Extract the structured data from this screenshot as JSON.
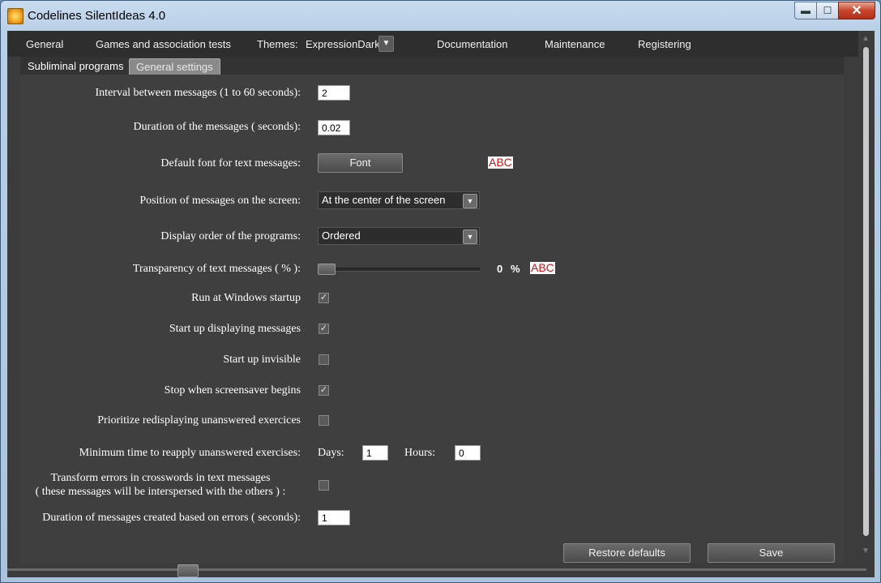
{
  "window": {
    "title": "Codelines SilentIdeas 4.0",
    "min_icon": "minimize-icon",
    "max_icon": "maximize-icon",
    "close_icon": "close-icon"
  },
  "menu": {
    "items": [
      "General",
      "Games and association tests",
      "Themes:",
      "Documentation",
      "Maintenance",
      "Registering"
    ],
    "theme_value": "ExpressionDark"
  },
  "subtabs": [
    "Subliminal programs",
    "General settings"
  ],
  "form": {
    "interval_label": "Interval between messages (1 to 60 seconds):",
    "interval_value": "2",
    "duration_label": "Duration of the messages ( seconds):",
    "duration_value": "0.02",
    "font_label": "Default font for text messages:",
    "font_button": "Font",
    "font_preview": "ABC",
    "position_label": "Position of messages on the screen:",
    "position_value": "At the center of the screen",
    "order_label": "Display order of the programs:",
    "order_value": "Ordered",
    "transparency_label": "Transparency of text messages ( % ):",
    "transparency_value": "0",
    "transparency_unit": "%",
    "transparency_preview": "ABC",
    "run_startup_label": "Run at Windows startup",
    "run_startup_checked": true,
    "start_displaying_label": "Start up displaying messages",
    "start_displaying_checked": true,
    "start_invisible_label": "Start up invisible",
    "start_invisible_checked": false,
    "stop_screensaver_label": "Stop when screensaver begins",
    "stop_screensaver_checked": true,
    "prioritize_label": "Prioritize redisplaying unanswered exercices",
    "prioritize_checked": false,
    "min_time_label": "Minimum time to reapply unanswered exercises:",
    "days_label": "Days:",
    "days_value": "1",
    "hours_label": "Hours:",
    "hours_value": "0",
    "transform_label_1": "Transform errors in crosswords in text messages",
    "transform_label_2": "( these messages will be interspersed with the others ) :",
    "transform_checked": false,
    "errors_duration_label": "Duration of messages created based on errors ( seconds):",
    "errors_duration_value": "1"
  },
  "buttons": {
    "restore": "Restore defaults",
    "save": "Save"
  },
  "colors": {
    "panel_bg": "#3f3f3f",
    "preview_text": "#dd1111"
  }
}
